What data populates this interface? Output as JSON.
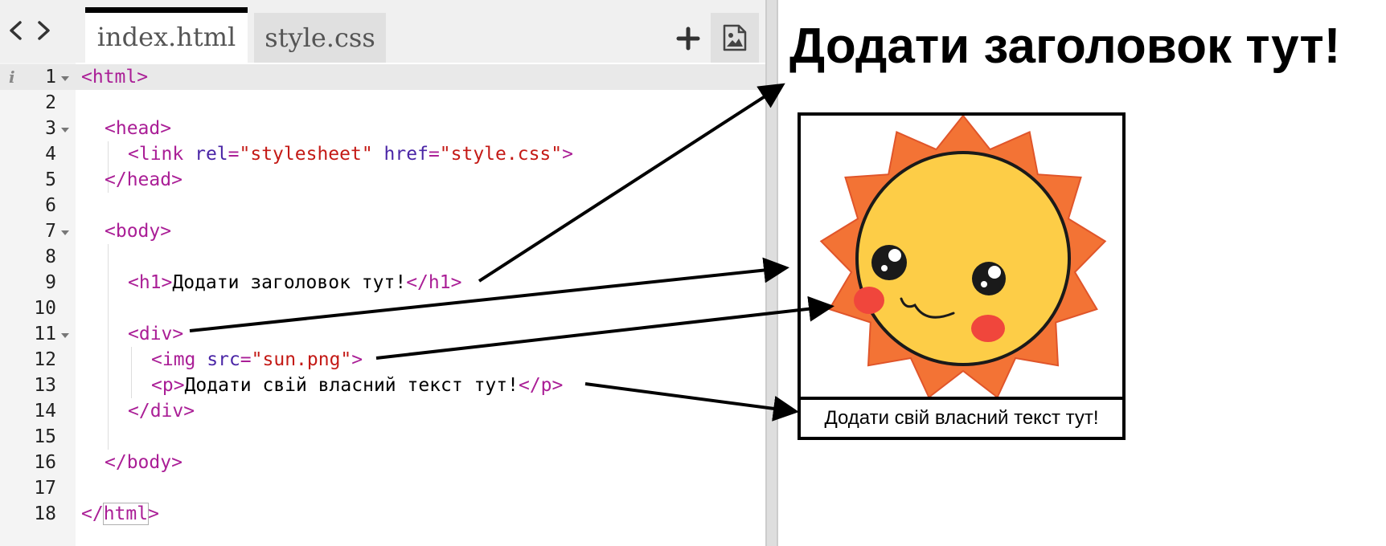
{
  "editor": {
    "tabs": [
      {
        "label": "index.html",
        "active": true
      },
      {
        "label": "style.css",
        "active": false
      }
    ],
    "line_numbers": [
      "1",
      "2",
      "3",
      "4",
      "5",
      "6",
      "7",
      "8",
      "9",
      "10",
      "11",
      "12",
      "13",
      "14",
      "15",
      "16",
      "17",
      "18"
    ],
    "code": {
      "l1": {
        "t1": "<html>"
      },
      "l3": {
        "t1": "<head>"
      },
      "l4": {
        "t1": "<link",
        "a1": "rel",
        "e1": "=",
        "s1": "\"stylesheet\"",
        "a2": "href",
        "e2": "=",
        "s2": "\"style.css\"",
        "t2": ">"
      },
      "l5": {
        "t1": "</head>"
      },
      "l7": {
        "t1": "<body>"
      },
      "l9": {
        "t1": "<h1>",
        "text": "Додати заголовок тут!",
        "t2": "</h1>"
      },
      "l11": {
        "t1": "<div>"
      },
      "l12": {
        "t1": "<img",
        "a1": "src",
        "e1": "=",
        "s1": "\"sun.png\"",
        "t2": ">"
      },
      "l13": {
        "t1": "<p>",
        "text": "Додати свій власний текст тут!",
        "t2": "</p>"
      },
      "l14": {
        "t1": "</div>"
      },
      "l16": {
        "t1": "</body>"
      },
      "l18": {
        "t1": "</",
        "t2": "html",
        "t3": ">"
      }
    },
    "info_glyph": "i",
    "icons": [
      "chevron-left-icon",
      "chevron-right-icon",
      "plus-icon",
      "image-icon",
      "fold-arrow-icon",
      "info-icon"
    ]
  },
  "preview": {
    "heading": "Додати заголовок тут!",
    "caption": "Додати свій власний текст тут!"
  },
  "colors": {
    "tag": "#aa1e96",
    "attribute": "#4a25a6",
    "string": "#c41a16",
    "sun_rays": "#f37335",
    "sun_face": "#fdcd47",
    "cheeks": "#f0463c"
  }
}
